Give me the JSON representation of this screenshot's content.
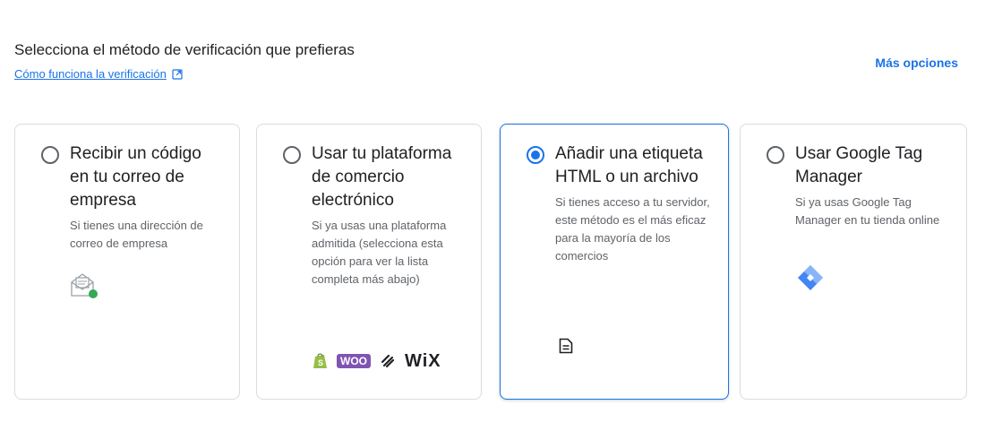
{
  "header": {
    "title": "Selecciona el método de verificación que prefieras",
    "help_link": "Cómo funciona la verificación",
    "more_options": "Más opciones"
  },
  "cards": [
    {
      "title": "Recibir un código en tu correo de empresa",
      "description": "Si tienes una dirección de correo de empresa",
      "selected": false,
      "icon": "email-verification-icon"
    },
    {
      "title": "Usar tu plataforma de comercio electrónico",
      "description": "Si ya usas una plataforma admitida (selecciona esta opción para ver la lista completa más abajo)",
      "selected": false,
      "icon": "platform-logos",
      "platforms": [
        "shopify-logo",
        "woocommerce-logo",
        "squarespace-logo",
        "wix-logo"
      ],
      "woo_label": "WOO",
      "wix_label": "WiX"
    },
    {
      "title": "Añadir una etiqueta HTML o un archivo",
      "description": "Si tienes acceso a tu servidor, este método es el más eficaz para la mayoría de los comercios",
      "selected": true,
      "icon": "document-icon"
    },
    {
      "title": "Usar Google Tag Manager",
      "description": "Si ya usas Google Tag Manager en tu tienda online",
      "selected": false,
      "icon": "google-tag-manager-icon"
    }
  ],
  "colors": {
    "accent": "#1a73e8",
    "border": "#dadce0",
    "text": "#202124",
    "secondary_text": "#5f6368"
  }
}
